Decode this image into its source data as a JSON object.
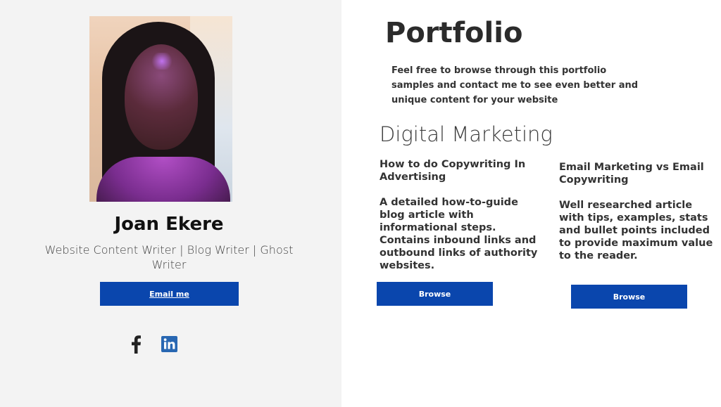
{
  "profile": {
    "name": "Joan Ekere",
    "tagline": "Website Content Writer | Blog Writer | Ghost Writer",
    "email_button": "Email me",
    "social": [
      {
        "icon": "facebook-icon"
      },
      {
        "icon": "linkedin-icon"
      }
    ]
  },
  "portfolio": {
    "title": "Portfolio",
    "intro": "Feel free to browse through this portfolio samples and contact me to see even better and unique content for your website",
    "section_title": "Digital Marketing",
    "cards": [
      {
        "title": " How to do Copywriting In Advertising",
        "description": "A detailed how-to-guide blog article with informational steps. Contains inbound links and outbound links of authority websites.",
        "button": "Browse"
      },
      {
        "title": "Email Marketing vs Email Copywriting",
        "description": "Well researched article with tips, examples, stats and bullet points included to provide maximum value to the reader.",
        "button": "Browse"
      }
    ]
  },
  "colors": {
    "accent": "#0a46ad",
    "left_panel_bg": "#f3f3f3",
    "linkedin": "#2867b2"
  }
}
